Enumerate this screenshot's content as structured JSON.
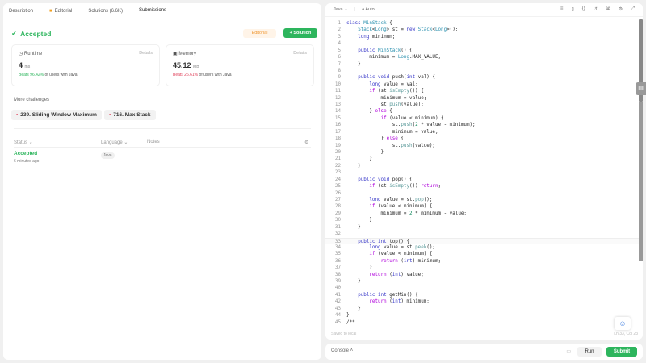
{
  "left": {
    "tabs": [
      {
        "label": "Description"
      },
      {
        "label": "Editorial"
      },
      {
        "label": "Solutions (6.6K)"
      },
      {
        "label": "Submissions"
      }
    ],
    "status": "Accepted",
    "editorial_button": "Editorial",
    "solution_button": "+ Solution",
    "runtime": {
      "title": "Runtime",
      "details": "Details",
      "value": "4",
      "unit": "ms",
      "beats": "Beats 96.42%",
      "suffix": "of users with Java"
    },
    "memory": {
      "title": "Memory",
      "details": "Details",
      "value": "45.12",
      "unit": "MB",
      "beats": "Beats 26.61%",
      "suffix": "of users with Java"
    },
    "more_challenges": "More challenges",
    "challenges": [
      "239. Sliding Window Maximum",
      "716. Max Stack"
    ],
    "table": {
      "headers": [
        "Status",
        "Language",
        "Notes"
      ],
      "rows": [
        {
          "status": "Accepted",
          "time": "6 minutes ago",
          "language": "Java"
        }
      ]
    }
  },
  "editor": {
    "language": "Java",
    "mode": "Auto",
    "saved": "Saved to local",
    "cursor": "Ln 33, Col 23",
    "lines": [
      "class MinStack {",
      "    Stack<Long> st = new Stack<Long>();",
      "    long minimum;",
      "",
      "    public MinStack() {",
      "        minimum = Long.MAX_VALUE;",
      "    }",
      "",
      "    public void push(int val) {",
      "        long value = val;",
      "        if (st.isEmpty()) {",
      "            minimum = value;",
      "            st.push(value);",
      "        } else {",
      "            if (value < minimum) {",
      "                st.push(2 * value - minimum);",
      "                minimum = value;",
      "            } else {",
      "                st.push(value);",
      "            }",
      "        }",
      "    }",
      "",
      "    public void pop() {",
      "        if (st.isEmpty()) return;",
      "",
      "        long value = st.pop();",
      "        if (value < minimum) {",
      "            minimum = 2 * minimum - value;",
      "        }",
      "    }",
      "",
      "    public int top() {",
      "        long value = st.peek();",
      "        if (value < minimum) {",
      "            return (int) minimum;",
      "        }",
      "        return (int) value;",
      "    }",
      "",
      "    public int getMin() {",
      "        return (int) minimum;",
      "    }",
      "}",
      "/**"
    ]
  },
  "console": {
    "label": "Console",
    "run": "Run",
    "submit": "Submit"
  }
}
